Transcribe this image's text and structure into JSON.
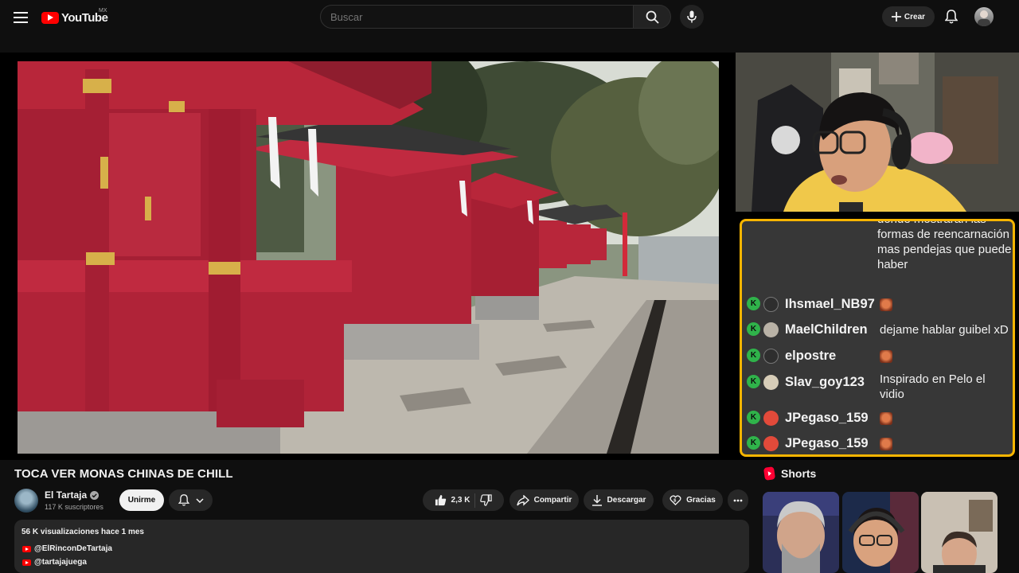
{
  "header": {
    "logo_text": "YouTube",
    "region": "MX",
    "search_placeholder": "Buscar",
    "create_label": "Crear"
  },
  "chat": {
    "messages": [
      {
        "user": "",
        "text": "formas de reencarnación mas pendejas que puede haber",
        "partial_top": "donde mostrarán las"
      },
      {
        "user": "Ihsmael_NB97",
        "text": "",
        "emote": "emote"
      },
      {
        "user": "MaelChildren",
        "text": "dejame hablar guibel xD"
      },
      {
        "user": "elpostre",
        "text": "",
        "emote": "emote"
      },
      {
        "user": "Slav_goy123",
        "text": "Inspirado en Pelo el vidio"
      },
      {
        "user": "JPegaso_159",
        "text": "",
        "emote": "emote"
      },
      {
        "user": "JPegaso_159",
        "text": "",
        "emote": "emote"
      }
    ],
    "badge": "K",
    "border_color": "#f7b500"
  },
  "video": {
    "title": "TOCA VER MONAS CHINAS DE CHILL"
  },
  "channel": {
    "name": "El Tartaja",
    "subscribers": "117 K suscriptores",
    "join_label": "Unirme"
  },
  "actions": {
    "likes": "2,3 K",
    "share": "Compartir",
    "download": "Descargar",
    "thanks": "Gracias"
  },
  "description": {
    "meta": "56 K visualizaciones  hace 1 mes",
    "links": [
      "@ElRinconDeTartaja",
      "@tartajajuega"
    ]
  },
  "shorts": {
    "heading": "Shorts"
  },
  "colors": {
    "background": "#0f0f0f",
    "accent": "#ff0000",
    "chip": "#272727",
    "shrine_red": "#b8263a"
  }
}
